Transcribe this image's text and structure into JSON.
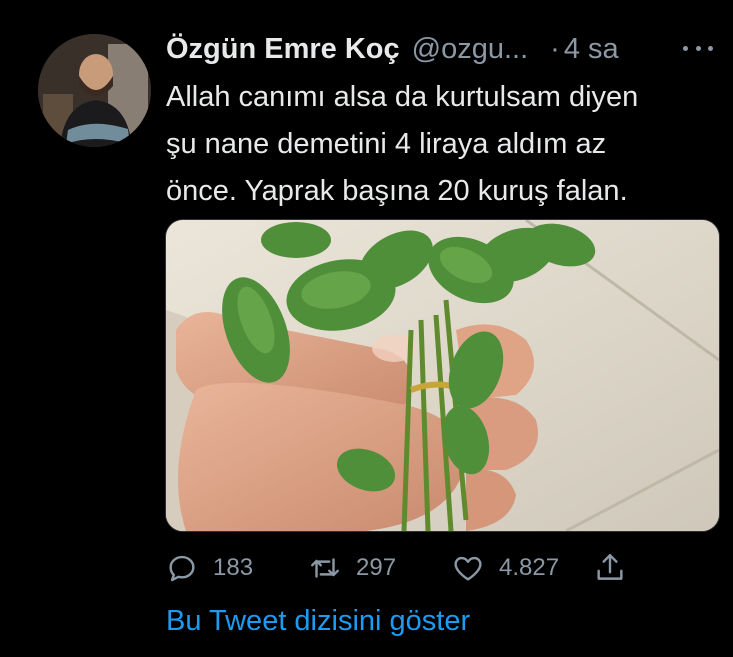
{
  "author": {
    "display_name": "Özgün Emre Koç",
    "handle": "@ozgu...",
    "separator": "·",
    "time": "4 sa"
  },
  "tweet": {
    "text": "Allah canımı alsa da kurtulsam diyen\nşu nane demetini 4 liraya aldım az\nönce. Yaprak başına 20 kuruş falan."
  },
  "media": {
    "description_icon": "photo-mint-bunch-in-hand"
  },
  "actions": {
    "replies": "183",
    "retweets": "297",
    "likes": "4.827"
  },
  "show_thread_label": "Bu Tweet dizisini göster",
  "colors": {
    "background": "#000000",
    "primary_text": "#e7e9ea",
    "secondary_text": "#8b98a5",
    "link": "#1d9bf0"
  }
}
